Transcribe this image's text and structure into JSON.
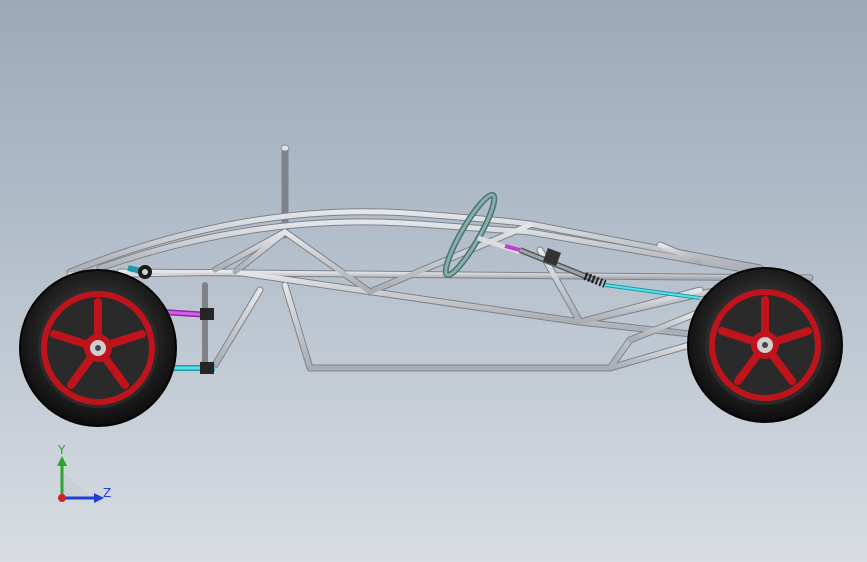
{
  "viewport": {
    "background_top": "#9ba9b8",
    "background_bottom": "#d9dde3"
  },
  "model": {
    "icon": "tube-frame-buggy-chassis",
    "colors": {
      "frame_tube": "#c9ccd1",
      "tire": "#141414",
      "rim": "#c0141c",
      "hub": "#d0d0d0",
      "control_arm_magenta": "#c23bd6",
      "steering_rod_cyan": "#2ec9d6",
      "steering_wheel": "#6f9c9c"
    }
  },
  "triad": {
    "y_label": "Y",
    "z_label": "Z",
    "y_color": "#2fa52f",
    "z_color": "#1f3fd6",
    "origin_color": "#d42020"
  }
}
